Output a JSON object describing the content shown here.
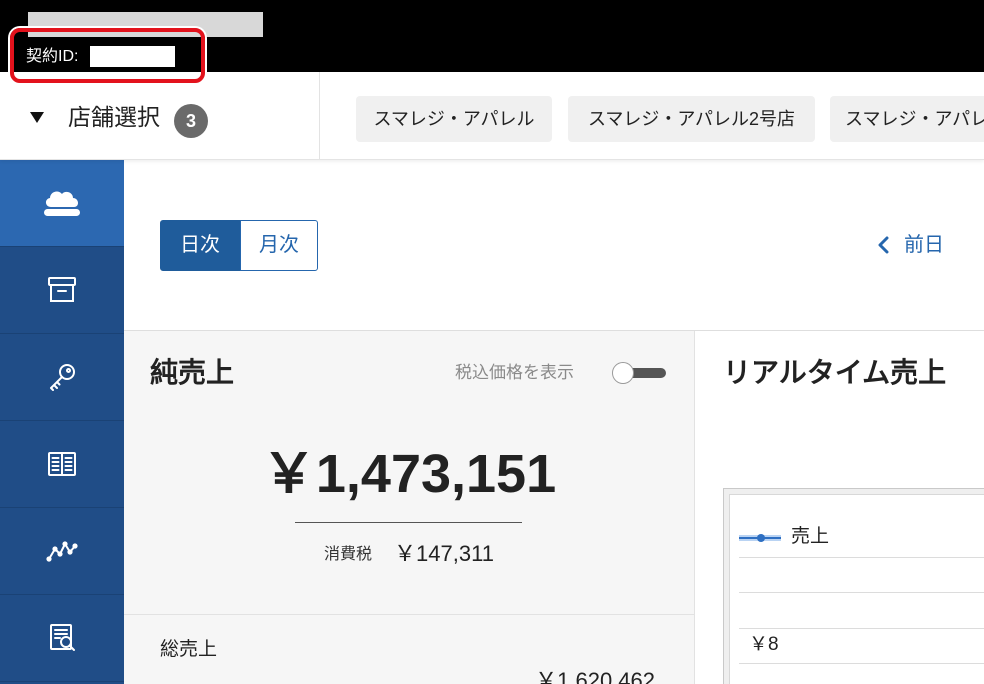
{
  "top_bar": {
    "contract_id_label": "契約ID:"
  },
  "store_selector": {
    "toggle_icon": "caret-down-icon",
    "title": "店舗選択",
    "count": "3",
    "stores": [
      "スマレジ・アパレル",
      "スマレジ・アパレル2号店",
      "スマレジ・アパレ"
    ]
  },
  "sidebar": {
    "items": [
      {
        "icon": "cloud-icon",
        "active": true
      },
      {
        "icon": "archive-box-icon",
        "active": false
      },
      {
        "icon": "key-icon",
        "active": false
      },
      {
        "icon": "book-icon",
        "active": false
      },
      {
        "icon": "chart-line-icon",
        "active": false
      },
      {
        "icon": "report-search-icon",
        "active": false
      }
    ]
  },
  "period_toggle": {
    "options": [
      "日次",
      "月次"
    ],
    "selected": "日次"
  },
  "date_nav": {
    "prev_icon": "chevron-left-icon",
    "prev_label": "前日"
  },
  "net_sales": {
    "title": "純売上",
    "tax_toggle_label": "税込価格を表示",
    "tax_toggle_on": false,
    "amount": "￥1,473,151",
    "tax_label": "消費税",
    "tax_amount": "￥147,311",
    "gross_label": "総売上",
    "gross_amount": "￥1,620,462"
  },
  "realtime_sales": {
    "title": "リアルタイム売上",
    "legend_label": "売上",
    "row_value": "￥8"
  },
  "colors": {
    "sidebar_bg": "#204d87",
    "sidebar_active": "#2c68b1",
    "accent": "#2566ad",
    "highlight": "#e3121c"
  }
}
